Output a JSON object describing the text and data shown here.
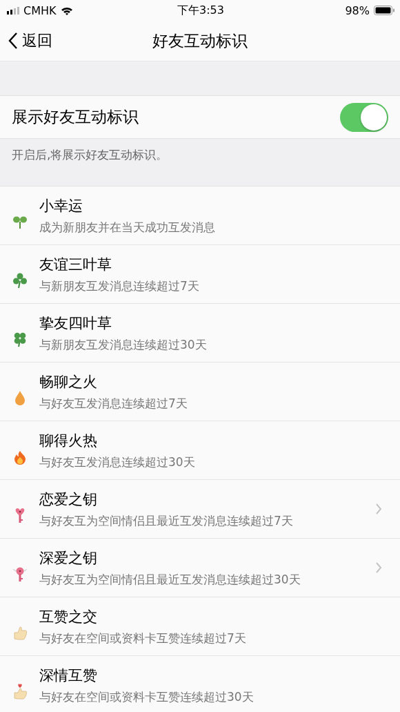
{
  "status_bar": {
    "carrier": "CMHK",
    "time": "下午3:53",
    "battery": "98%"
  },
  "nav": {
    "back": "返回",
    "title": "好友互动标识"
  },
  "setting": {
    "label": "展示好友互动标识",
    "on": true,
    "note": "开启后,将展示好友互动标识。"
  },
  "items": [
    {
      "kind": "sprout",
      "title": "小幸运",
      "desc": "成为新朋友并在当天成功互发消息",
      "chevron": false
    },
    {
      "kind": "clover3",
      "title": "友谊三叶草",
      "desc": "与新朋友互发消息连续超过7天",
      "chevron": false
    },
    {
      "kind": "clover4",
      "title": "挚友四叶草",
      "desc": "与新朋友互发消息连续超过30天",
      "chevron": false
    },
    {
      "kind": "flame",
      "title": "畅聊之火",
      "desc": "与好友互发消息连续超过7天",
      "chevron": false
    },
    {
      "kind": "fire",
      "title": "聊得火热",
      "desc": "与好友互发消息连续超过30天",
      "chevron": false
    },
    {
      "kind": "heartkey",
      "title": "恋爱之钥",
      "desc": "与好友互为空间情侣且最近互发消息连续超过7天",
      "chevron": true
    },
    {
      "kind": "wingkey",
      "title": "深爱之钥",
      "desc": "与好友互为空间情侣且最近互发消息连续超过30天",
      "chevron": true
    },
    {
      "kind": "thumb",
      "title": "互赞之交",
      "desc": "与好友在空间或资料卡互赞连续超过7天",
      "chevron": false
    },
    {
      "kind": "thumbheart",
      "title": "深情互赞",
      "desc": "与好友在空间或资料卡互赞连续超过30天",
      "chevron": false
    }
  ]
}
